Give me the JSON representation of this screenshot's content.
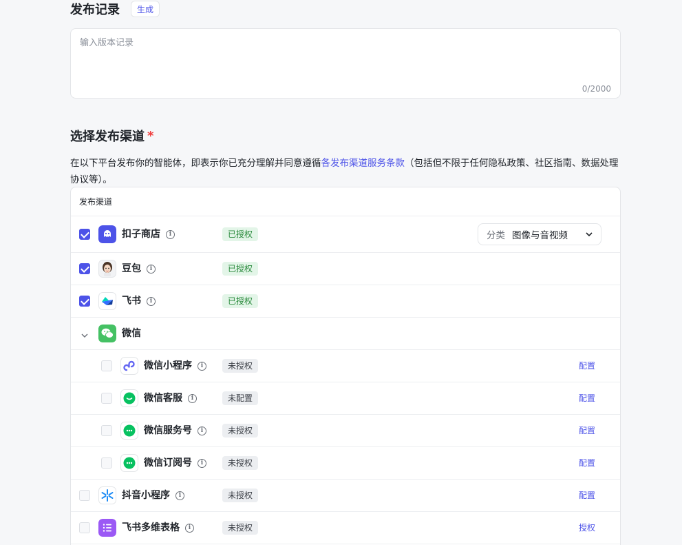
{
  "release": {
    "title": "发布记录",
    "generate_label": "生成",
    "placeholder": "输入版本记录",
    "counter": "0/2000"
  },
  "channels": {
    "title": "选择发布渠道",
    "required_mark": "*",
    "notice_prefix": "在以下平台发布你的智能体，即表示你已充分理解并同意遵循",
    "notice_link": "各发布渠道服务条款",
    "notice_suffix": "（包括但不限于任何隐私政策、社区指南、数据处理协议等）。",
    "table_header": "发布渠道",
    "category": {
      "label": "分类",
      "value": "图像与音视频"
    },
    "info_glyph": "i",
    "rows": [
      {
        "name": "扣子商店",
        "checked": true,
        "status": "已授权",
        "status_type": "ok",
        "icon": "coze-store-icon"
      },
      {
        "name": "豆包",
        "checked": true,
        "status": "已授权",
        "status_type": "ok",
        "icon": "doubao-icon"
      },
      {
        "name": "飞书",
        "checked": true,
        "status": "已授权",
        "status_type": "ok",
        "icon": "feishu-icon"
      },
      {
        "name": "微信",
        "icon": "wechat-icon",
        "group": true,
        "expanded": true
      },
      {
        "name": "微信小程序",
        "checked": false,
        "status": "未授权",
        "status_type": "no",
        "action": "配置",
        "icon": "wechat-miniprogram-icon",
        "child": true
      },
      {
        "name": "微信客服",
        "checked": false,
        "status": "未配置",
        "status_type": "no",
        "action": "配置",
        "icon": "wechat-service-icon",
        "child": true
      },
      {
        "name": "微信服务号",
        "checked": false,
        "status": "未授权",
        "status_type": "no",
        "action": "配置",
        "icon": "wechat-official-icon",
        "child": true
      },
      {
        "name": "微信订阅号",
        "checked": false,
        "status": "未授权",
        "status_type": "no",
        "action": "配置",
        "icon": "wechat-subscription-icon",
        "child": true
      },
      {
        "name": "抖音小程序",
        "checked": false,
        "status": "未授权",
        "status_type": "no",
        "action": "配置",
        "icon": "douyin-miniprogram-icon"
      },
      {
        "name": "飞书多维表格",
        "checked": false,
        "status": "未授权",
        "status_type": "no",
        "action": "授权",
        "icon": "feishu-bitable-icon"
      }
    ]
  },
  "colors": {
    "accent": "#4d53e8",
    "authorized_bg": "#e3f5e8",
    "authorized_text": "#2a8a3c",
    "required": "#f03e3e"
  }
}
